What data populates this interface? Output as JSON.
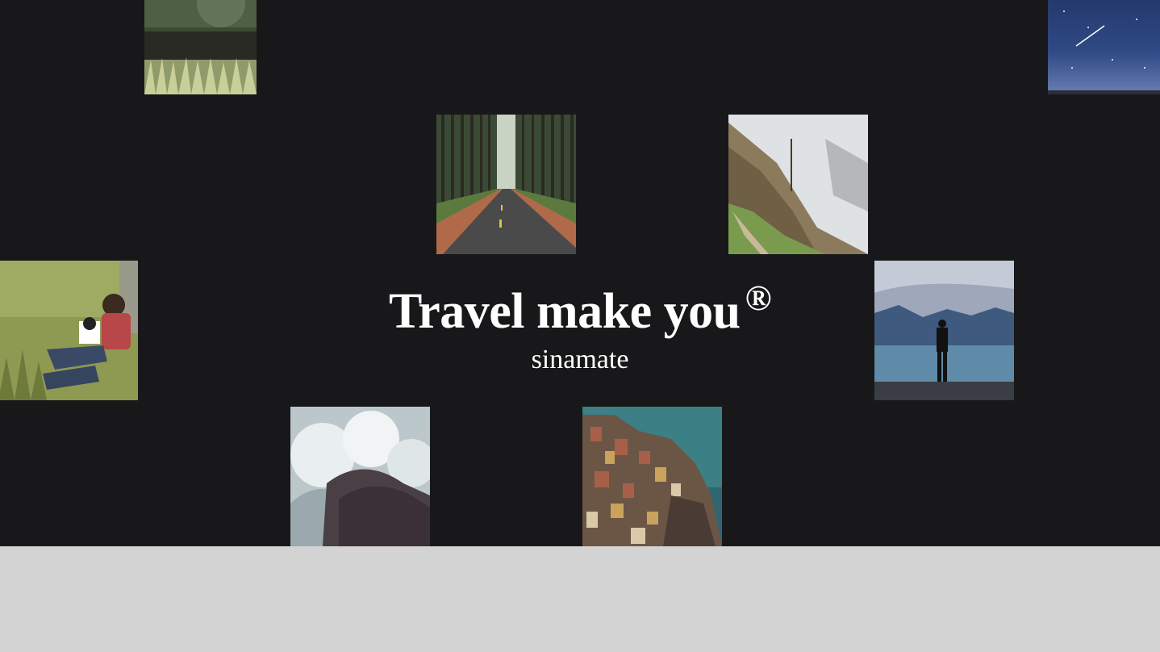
{
  "hero": {
    "title": "Travel make you",
    "title_mark": "®",
    "subtitle": "sinamate"
  },
  "colors": {
    "hero_background": "#18181a",
    "page_background": "#d3d3d3",
    "text": "#ffffff"
  },
  "gallery": [
    {
      "name": "grass-photo"
    },
    {
      "name": "starry-sky-photo"
    },
    {
      "name": "forest-road-photo"
    },
    {
      "name": "misty-forest-photo"
    },
    {
      "name": "man-reading-in-grass-photo"
    },
    {
      "name": "person-by-lake-photo"
    },
    {
      "name": "crashing-waves-photo"
    },
    {
      "name": "cliffside-village-photo"
    }
  ]
}
